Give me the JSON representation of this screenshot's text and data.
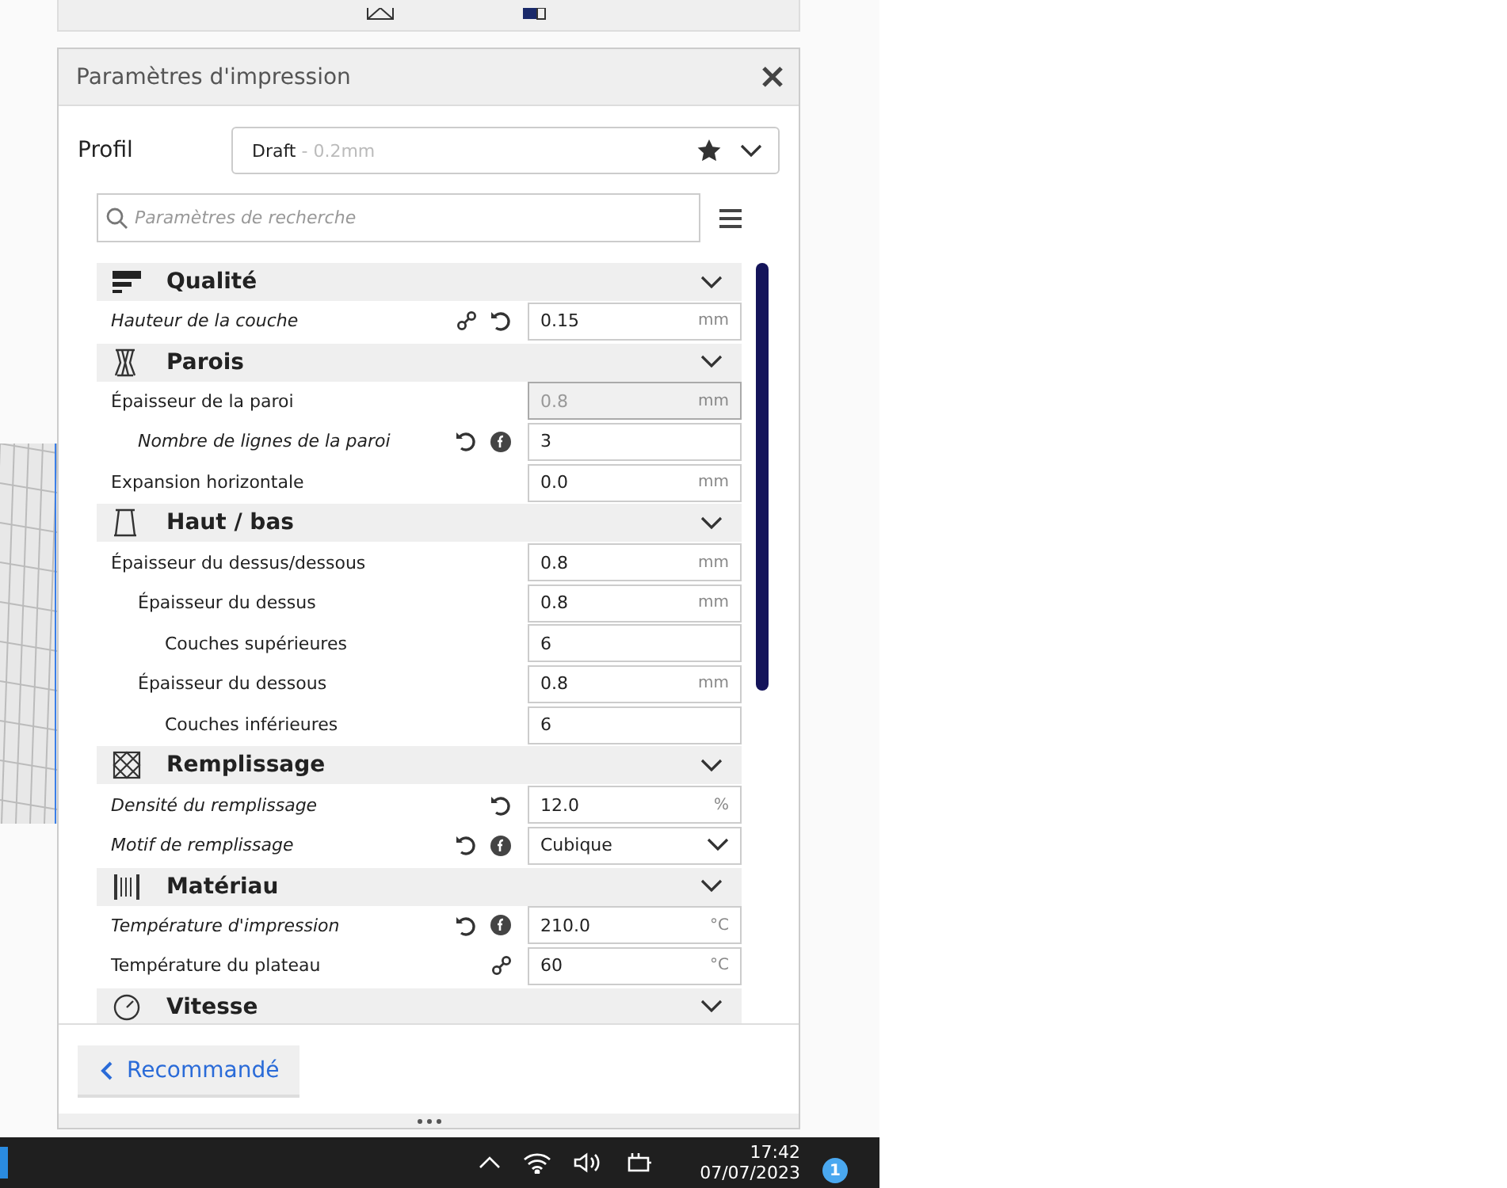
{
  "panel": {
    "title": "Paramètres d'impression",
    "profile": {
      "label": "Profil",
      "name": "Draft",
      "detail": " - 0.2mm"
    },
    "search": {
      "placeholder": "Paramètres de recherche"
    },
    "sections": [
      {
        "kind": "quality",
        "title": "Qualité",
        "settings": [
          {
            "label": "Hauteur de la couche",
            "kind": "input",
            "value": "0.15",
            "unit": "mm",
            "modified": true,
            "linked": true,
            "resettable": true,
            "formula": false,
            "disabled": false
          }
        ]
      },
      {
        "kind": "walls",
        "title": "Parois",
        "settings": [
          {
            "label": "Épaisseur de la paroi",
            "kind": "input",
            "value": "0.8",
            "unit": "mm",
            "modified": false,
            "linked": false,
            "resettable": false,
            "formula": false,
            "disabled": true,
            "children": [
              {
                "label": "Nombre de lignes de la paroi",
                "kind": "input",
                "value": "3",
                "modified": true,
                "linked": false,
                "resettable": true,
                "formula": true,
                "disabled": false
              }
            ]
          },
          {
            "label": "Expansion horizontale",
            "kind": "input",
            "value": "0.0",
            "unit": "mm",
            "modified": false,
            "linked": false,
            "resettable": false,
            "formula": false,
            "disabled": false
          }
        ]
      },
      {
        "kind": "topbottom",
        "title": "Haut / bas",
        "settings": [
          {
            "label": "Épaisseur du dessus/dessous",
            "kind": "input",
            "value": "0.8",
            "unit": "mm",
            "modified": false,
            "linked": false,
            "resettable": false,
            "formula": false,
            "disabled": false,
            "children": [
              {
                "label": "Épaisseur du dessus",
                "kind": "input",
                "value": "0.8",
                "unit": "mm",
                "modified": false,
                "linked": false,
                "resettable": false,
                "formula": false,
                "disabled": false,
                "children": [
                  {
                    "label": "Couches supérieures",
                    "kind": "input",
                    "value": "6",
                    "modified": false,
                    "linked": false,
                    "resettable": false,
                    "formula": false,
                    "disabled": false
                  }
                ]
              },
              {
                "label": "Épaisseur du dessous",
                "kind": "input",
                "value": "0.8",
                "unit": "mm",
                "modified": false,
                "linked": false,
                "resettable": false,
                "formula": false,
                "disabled": false,
                "children": [
                  {
                    "label": "Couches inférieures",
                    "kind": "input",
                    "value": "6",
                    "modified": false,
                    "linked": false,
                    "resettable": false,
                    "formula": false,
                    "disabled": false
                  }
                ]
              }
            ]
          }
        ]
      },
      {
        "kind": "infill",
        "title": "Remplissage",
        "settings": [
          {
            "label": "Densité du remplissage",
            "kind": "input",
            "value": "12.0",
            "unit": "%",
            "modified": true,
            "linked": false,
            "resettable": true,
            "formula": false,
            "disabled": false
          },
          {
            "label": "Motif de remplissage",
            "kind": "select",
            "value": "Cubique",
            "modified": true,
            "linked": false,
            "resettable": true,
            "formula": true,
            "disabled": false
          }
        ]
      },
      {
        "kind": "material",
        "title": "Matériau",
        "settings": [
          {
            "label": "Température d'impression",
            "kind": "input",
            "value": "210.0",
            "unit": "°C",
            "modified": true,
            "linked": false,
            "resettable": true,
            "formula": true,
            "disabled": false
          },
          {
            "label": "Température du plateau",
            "kind": "input",
            "value": "60",
            "unit": "°C",
            "modified": false,
            "linked": true,
            "resettable": false,
            "formula": false,
            "disabled": false
          }
        ]
      },
      {
        "kind": "speed",
        "title": "Vitesse"
      }
    ],
    "back_button": "Recommandé"
  },
  "taskbar": {
    "time": "17:42",
    "date": "07/07/2023",
    "notifications": "1"
  }
}
